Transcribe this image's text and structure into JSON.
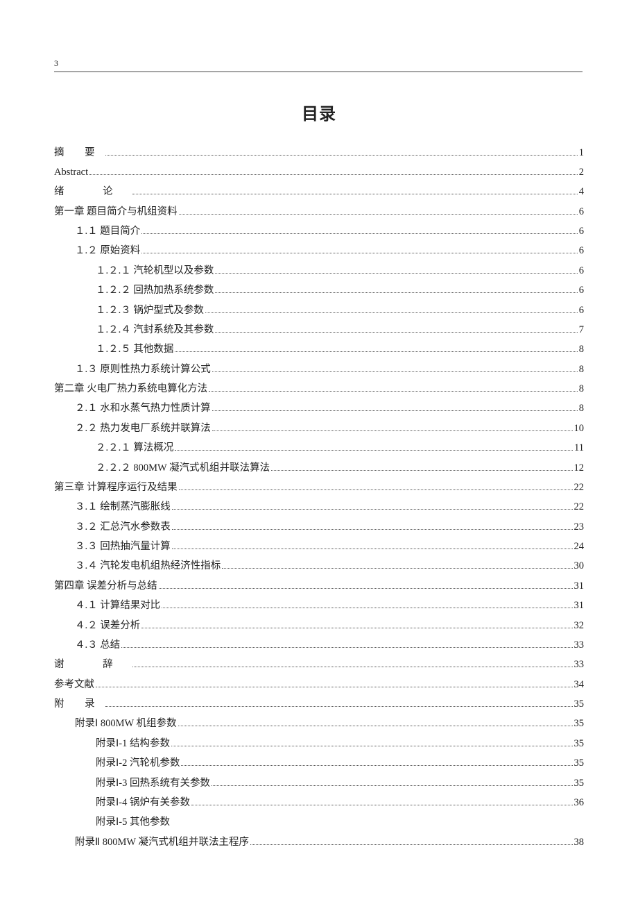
{
  "page_number": "3",
  "title": "目录",
  "toc": [
    {
      "label": "摘 要",
      "page": "1",
      "level": 0,
      "spaced": 1
    },
    {
      "label": "Abstract",
      "page": "2",
      "level": 0
    },
    {
      "label": "绪   论",
      "page": "4",
      "level": 0,
      "spaced": 2
    },
    {
      "label": "第一章  题目简介与机组资料",
      "page": "6",
      "level": 0
    },
    {
      "label": "１.１ 题目简介",
      "page": "6",
      "level": 1
    },
    {
      "label": "１.２ 原始资料",
      "page": "6",
      "level": 1
    },
    {
      "label": "１.２.１ 汽轮机型以及参数",
      "page": "6",
      "level": 2
    },
    {
      "label": "１.２.２ 回热加热系统参数",
      "page": "6",
      "level": 2
    },
    {
      "label": "１.２.３ 锅炉型式及参数",
      "page": "6",
      "level": 2
    },
    {
      "label": "１.２.４ 汽封系统及其参数",
      "page": "7",
      "level": 2
    },
    {
      "label": "１.２.５ 其他数据",
      "page": "8",
      "level": 2
    },
    {
      "label": "１.３ 原则性热力系统计算公式",
      "page": "8",
      "level": 1
    },
    {
      "label": "第二章   火电厂热力系统电算化方法",
      "page": "8",
      "level": 0
    },
    {
      "label": "２.１ 水和水蒸气热力性质计算",
      "page": "8",
      "level": 1
    },
    {
      "label": "２.２ 热力发电厂系统并联算法",
      "page": "10",
      "level": 1
    },
    {
      "label": "２.２.１ 算法概况",
      "page": "11",
      "level": 2
    },
    {
      "label": "２.２.２ 800MW 凝汽式机组并联法算法",
      "page": "12",
      "level": 2
    },
    {
      "label": "第三章   计算程序运行及结果",
      "page": "22",
      "level": 0
    },
    {
      "label": "３.１ 绘制蒸汽膨胀线",
      "page": "22",
      "level": 1
    },
    {
      "label": "３.２ 汇总汽水参数表",
      "page": "23",
      "level": 1
    },
    {
      "label": "３.３ 回热抽汽量计算",
      "page": "24",
      "level": 1
    },
    {
      "label": "３.４ 汽轮发电机组热经济性指标",
      "page": "30",
      "level": 1
    },
    {
      "label": "第四章   误差分析与总结",
      "page": "31",
      "level": 0
    },
    {
      "label": "４.１ 计算结果对比",
      "page": "31",
      "level": 1
    },
    {
      "label": "４.２ 误差分析",
      "page": "32",
      "level": 1
    },
    {
      "label": "４.３ 总结",
      "page": "33",
      "level": 1
    },
    {
      "label": "谢   辞",
      "page": "33",
      "level": 0,
      "spaced": 2
    },
    {
      "label": "参考文献",
      "page": "34",
      "level": 0
    },
    {
      "label": "附 录",
      "page": "35",
      "level": 0,
      "spaced": 1
    },
    {
      "label": "附录Ⅰ  800MW 机组参数",
      "page": "35",
      "level": 1
    },
    {
      "label": "附录Ⅰ-1  结构参数",
      "page": "35",
      "level": 2
    },
    {
      "label": "附录Ⅰ-2  汽轮机参数",
      "page": "35",
      "level": 2
    },
    {
      "label": "附录Ⅰ-3  回热系统有关参数",
      "page": "35",
      "level": 2
    },
    {
      "label": "附录Ⅰ-4  锅炉有关参数",
      "page": "36",
      "level": 2
    },
    {
      "label": "附录Ⅰ-5  其他参数",
      "page": "",
      "level": 2,
      "nodots": true
    },
    {
      "label": "附录Ⅱ  800MW 凝汽式机组并联法主程序",
      "page": "38",
      "level": 1
    }
  ]
}
